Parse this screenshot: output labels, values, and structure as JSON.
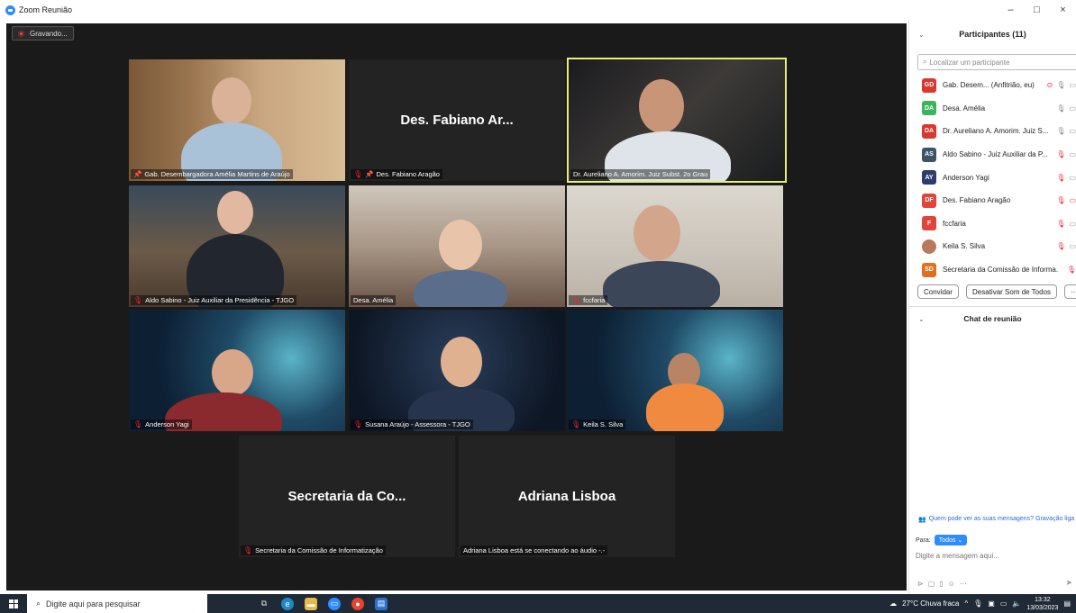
{
  "window": {
    "title": "Zoom Reunião",
    "minimize": "–",
    "maximize": "□",
    "close": "×"
  },
  "recording": {
    "label": "Gravando..."
  },
  "tiles": [
    {
      "label": "Gab. Desembargadora Amélia Martins de Araújo",
      "muted": false
    },
    {
      "bigname": "Des. Fabiano Ar...",
      "label": "Des. Fabiano Aragão",
      "muted": true
    },
    {
      "label": "Dr. Aureliano A. Amorim. Juiz Subst. 2o Grau",
      "muted": false,
      "active": true
    },
    {
      "label": "Aldo Sabino - Juiz Auxiliar da Presidência - TJGO",
      "muted": true
    },
    {
      "label": "Desa. Amélia",
      "muted": false
    },
    {
      "label": "fccfaria",
      "muted": true
    },
    {
      "label": "Anderson Yagi",
      "muted": true
    },
    {
      "label": "Susana Araújo - Assessora - TJGO",
      "muted": true
    },
    {
      "label": "Keila S. Silva",
      "muted": true
    },
    {
      "bigname": "Secretaria da Co...",
      "label": "Secretaria da Comissão de Informatização",
      "muted": true
    },
    {
      "bigname": "Adriana Lisboa",
      "label": "Adriana Lisboa está se conectando ao áudio -.-",
      "muted": false
    }
  ],
  "panel": {
    "title": "Participantes (11)",
    "search_placeholder": "Localizar um participante",
    "participants": [
      {
        "initials": "GD",
        "color": "#d9382e",
        "name": "Gab. Desem... (Anfitrião, eu)"
      },
      {
        "initials": "DA",
        "color": "#3cb55a",
        "name": "Desa. Amélia"
      },
      {
        "initials": "DA",
        "color": "#d9382e",
        "name": "Dr. Aureliano A. Amorim. Juiz S..."
      },
      {
        "initials": "AS",
        "color": "#3a5568",
        "name": "Aldo Sabino - Juiz Auxiliar da P..."
      },
      {
        "initials": "AY",
        "color": "#2b3e6b",
        "name": "Anderson Yagi"
      },
      {
        "initials": "DF",
        "color": "#e0443a",
        "name": "Des. Fabiano Aragão"
      },
      {
        "initials": "F",
        "color": "#e0443a",
        "name": "fccfaria"
      },
      {
        "initials": "",
        "color": "#b87a5c",
        "name": "Keila S. Silva"
      },
      {
        "initials": "SD",
        "color": "#e07020",
        "name": "Secretaria da Comissão de Informa..."
      }
    ],
    "invite_label": "Convidar",
    "mute_all_label": "Desativar Som de Todos",
    "more_label": "···",
    "chat_title": "Chat de reunião",
    "chat_note": "Quem pode ver as suas mensagens? Gravação liga",
    "to_label": "Para:",
    "to_value": "Todos ⌄",
    "chat_placeholder": "Digite a mensagem aqui..."
  },
  "taskbar": {
    "search_placeholder": "Digite aqui para pesquisar",
    "weather": "27°C  Chuva fraca",
    "time": "13:32",
    "date": "13/03/2023"
  }
}
